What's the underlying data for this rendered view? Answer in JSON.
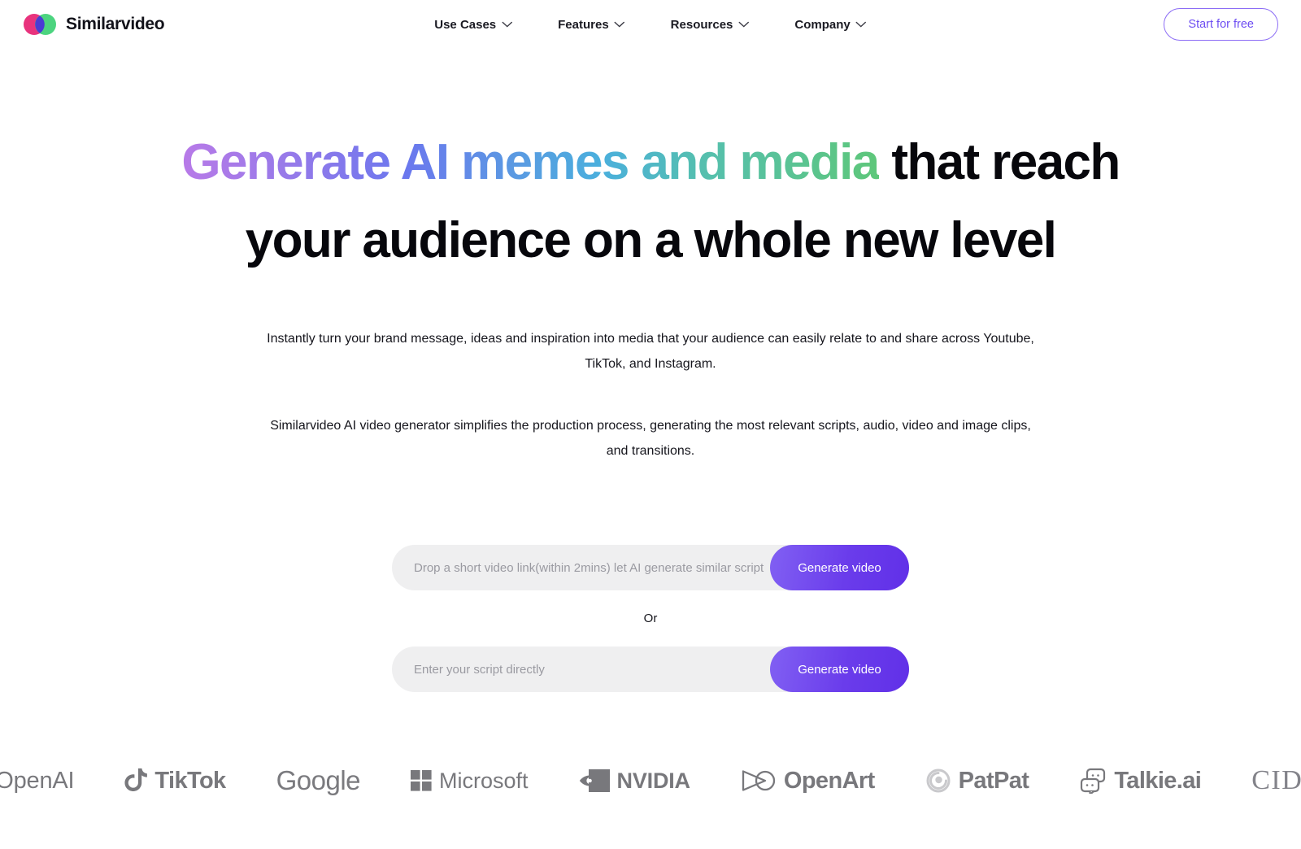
{
  "header": {
    "brand": {
      "name": "Similarvideo",
      "mark_icon": "overlapping-circles-logo"
    },
    "nav": [
      {
        "label": "Use Cases",
        "icon": "chevron-down-icon"
      },
      {
        "label": "Features",
        "icon": "chevron-down-icon"
      },
      {
        "label": "Resources",
        "icon": "chevron-down-icon"
      },
      {
        "label": "Company",
        "icon": "chevron-down-icon"
      }
    ],
    "cta": {
      "label": "Start for free"
    }
  },
  "hero": {
    "headline_gradient": "Generate AI memes and media",
    "headline_rest": " that reach your audience on a whole new level",
    "subtitle_1": "Instantly turn your brand message, ideas and inspiration into media that your audience can easily relate to and share across Youtube, TikTok, and Instagram.",
    "subtitle_2": "Similarvideo AI video generator simplifies the production process, generating the most relevant scripts, audio, video and image clips, and transitions."
  },
  "form": {
    "link_input": {
      "placeholder": "Drop a short video link(within 2mins) let AI generate similar script",
      "value": "",
      "button_label": "Generate video"
    },
    "divider_label": "Or",
    "script_input": {
      "placeholder": "Enter your script directly",
      "value": "",
      "button_label": "Generate video"
    }
  },
  "logos": [
    {
      "name": "OpenAI",
      "icon": "openai-icon"
    },
    {
      "name": "TikTok",
      "icon": "tiktok-icon"
    },
    {
      "name": "Google",
      "icon": "none"
    },
    {
      "name": "Microsoft",
      "icon": "microsoft-icon"
    },
    {
      "name": "NVIDIA",
      "icon": "nvidia-icon"
    },
    {
      "name": "OpenArt",
      "icon": "openart-icon"
    },
    {
      "name": "PatPat",
      "icon": "patpat-icon"
    },
    {
      "name": "Talkie.ai",
      "icon": "talkie-icon"
    },
    {
      "name": "CIDER",
      "icon": "none"
    }
  ],
  "colors": {
    "accent_purple": "#6d4df2",
    "button_gradient_start": "#8160f3",
    "button_gradient_end": "#6130e8",
    "logo_pink": "#e8337d",
    "logo_green": "#4cd47f",
    "logo_overlap": "#4a3bd4",
    "headline_gradient_start": "#b87ae8",
    "headline_gradient_mid": "#4aafdd",
    "headline_gradient_end": "#5ec77a",
    "input_background": "#efeff0",
    "logo_strip_gray": "#78787c"
  }
}
